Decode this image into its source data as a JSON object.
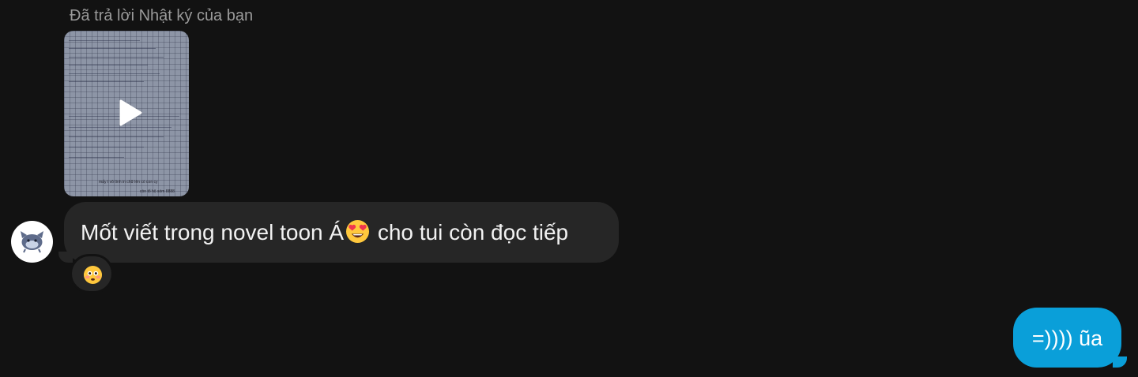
{
  "chat": {
    "reply_note": "Đã trả lời Nhật ký của bạn",
    "story": {
      "caption_line1": "mấy t vô tình in chữ lên có con cy",
      "caption_line2": "còn tổ hộ sóm 8888"
    },
    "incoming": {
      "text_before_emoji": "Mốt viết trong novel toon Á",
      "emoji": "smiling-face-with-heart-eyes",
      "text_after_emoji": " cho tui còn đọc tiếp",
      "reaction": "flushed-face"
    },
    "outgoing": {
      "text": "=)))) ũa"
    }
  },
  "colors": {
    "background": "#121212",
    "incoming_bubble": "#262626",
    "outgoing_bubble": "#0a9fd9",
    "meta_text": "#9a9a9a"
  }
}
